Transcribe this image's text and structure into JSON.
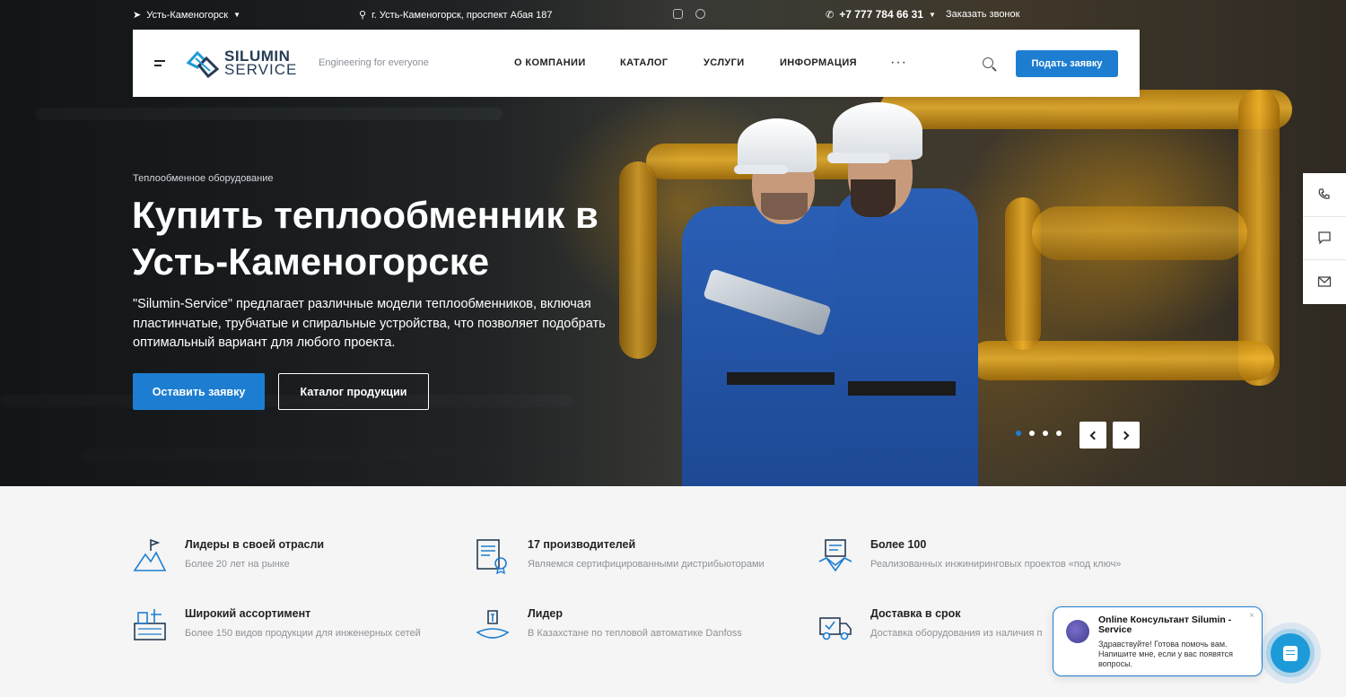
{
  "topbar": {
    "city": "Усть-Каменогорск",
    "address": "г. Усть-Каменогорск, проспект Абая 187",
    "phone": "+7 777 784 66 31",
    "callback": "Заказать звонок"
  },
  "header": {
    "logo_line1": "SILUMIN",
    "logo_line2": "SERVICE",
    "tagline": "Engineering for everyone",
    "nav": [
      "О КОМПАНИИ",
      "КАТАЛОГ",
      "УСЛУГИ",
      "ИНФОРМАЦИЯ"
    ],
    "more": "···",
    "apply_label": "Подать заявку"
  },
  "hero": {
    "eyebrow": "Теплообменное оборудование",
    "title": "Купить теплообменник в Усть-Каменогорске",
    "description": "\"Silumin-Service\" предлагает различные модели теплообменников, включая пластинчатые, трубчатые и спиральные устройства, что позволяет подобрать оптимальный вариант для любого проекта.",
    "primary_button": "Оставить заявку",
    "secondary_button": "Каталог продукции",
    "slides_total": 4,
    "active_slide": 1
  },
  "features": [
    {
      "title": "Лидеры в своей отрасли",
      "subtitle": "Более 20 лет на рынке",
      "icon": "mountain-flag-icon"
    },
    {
      "title": "17 производителей",
      "subtitle": "Являемся сертифицированными дистрибьюторами",
      "icon": "certificate-icon"
    },
    {
      "title": "Более 100",
      "subtitle": "Реализованных инжиниринговых проектов «под ключ»",
      "icon": "handshake-icon"
    },
    {
      "title": "Широкий ассортимент",
      "subtitle": "Более 150 видов продукции для инженерных сетей",
      "icon": "factory-icon"
    },
    {
      "title": "Лидер",
      "subtitle": "В Казахстане по тепловой автоматике Danfoss",
      "icon": "award-icon"
    },
    {
      "title": "Доставка в срок",
      "subtitle": "Доставка оборудования из наличия п",
      "icon": "truck-icon"
    }
  ],
  "chat": {
    "title": "Online Консультант Silumin - Service",
    "message": "Здравствуйте! Готова помочь вам. Напишите мне, если у вас появятся вопросы.",
    "close": "×"
  },
  "colors": {
    "accent": "#1d7ed1",
    "brand_dark": "#263c55",
    "chat": "#1d9bd8"
  }
}
